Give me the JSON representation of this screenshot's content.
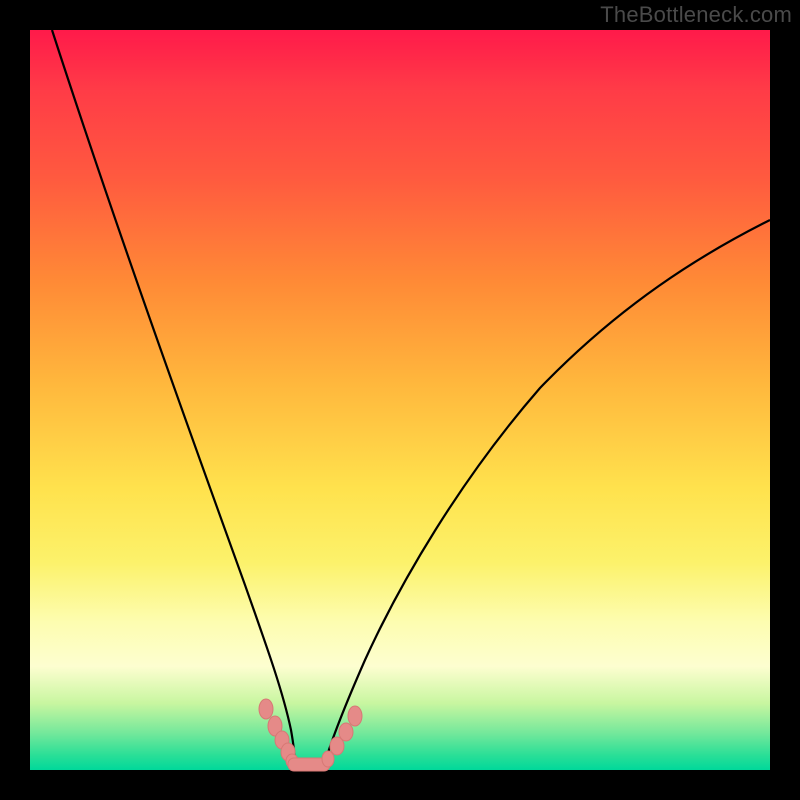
{
  "watermark": "TheBottleneck.com",
  "chart_data": {
    "type": "line",
    "title": "",
    "xlabel": "",
    "ylabel": "",
    "x_range_fraction": [
      0,
      1
    ],
    "y_range_fraction": [
      0,
      1
    ],
    "series": [
      {
        "name": "left-curve",
        "x": [
          0.03,
          0.08,
          0.13,
          0.18,
          0.23,
          0.27,
          0.3,
          0.325,
          0.345,
          0.355
        ],
        "y": [
          0.0,
          0.2,
          0.4,
          0.58,
          0.73,
          0.84,
          0.9,
          0.95,
          0.985,
          1.0
        ]
      },
      {
        "name": "valley-floor",
        "x": [
          0.355,
          0.395
        ],
        "y": [
          1.0,
          1.0
        ]
      },
      {
        "name": "right-curve",
        "x": [
          0.395,
          0.42,
          0.46,
          0.52,
          0.6,
          0.7,
          0.82,
          0.94,
          1.0
        ],
        "y": [
          1.0,
          0.96,
          0.9,
          0.8,
          0.66,
          0.51,
          0.38,
          0.29,
          0.25
        ]
      }
    ],
    "markers_left": [
      {
        "x": 0.317,
        "y": 0.921
      },
      {
        "x": 0.328,
        "y": 0.944
      },
      {
        "x": 0.337,
        "y": 0.962
      },
      {
        "x": 0.345,
        "y": 0.978
      },
      {
        "x": 0.352,
        "y": 0.99
      }
    ],
    "markers_right": [
      {
        "x": 0.402,
        "y": 0.988
      },
      {
        "x": 0.414,
        "y": 0.97
      },
      {
        "x": 0.425,
        "y": 0.952
      },
      {
        "x": 0.437,
        "y": 0.93
      }
    ],
    "valley_pill": {
      "x0": 0.352,
      "x1": 0.398,
      "y": 0.997
    },
    "background_gradient_note": "top red through orange/yellow to green at bottom; black frame border"
  }
}
